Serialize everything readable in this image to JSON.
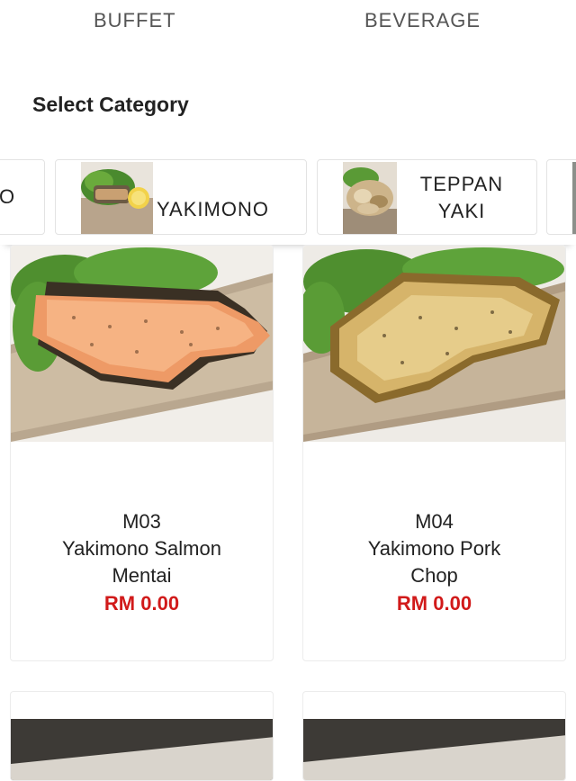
{
  "tabs": [
    {
      "label": "BUFFET"
    },
    {
      "label": "BEVERAGE"
    }
  ],
  "section_title": "Select Category",
  "categories": [
    {
      "label": "O",
      "icon": "food-thumbnail"
    },
    {
      "label": "YAKIMONO",
      "icon": "grilled-fish-thumbnail"
    },
    {
      "label_line1": "TEPPAN",
      "label_line2": "YAKI",
      "icon": "teppanyaki-thumbnail"
    }
  ],
  "products": [
    {
      "code": "M03",
      "name_line1": "Yakimono Salmon",
      "name_line2": "Mentai",
      "price": "RM 0.00"
    },
    {
      "code": "M04",
      "name_line1": "Yakimono Pork",
      "name_line2": "Chop",
      "price": "RM 0.00"
    }
  ],
  "colors": {
    "price": "#d11a1a",
    "tab_text": "#555555",
    "card_border": "#e3e3e3"
  }
}
